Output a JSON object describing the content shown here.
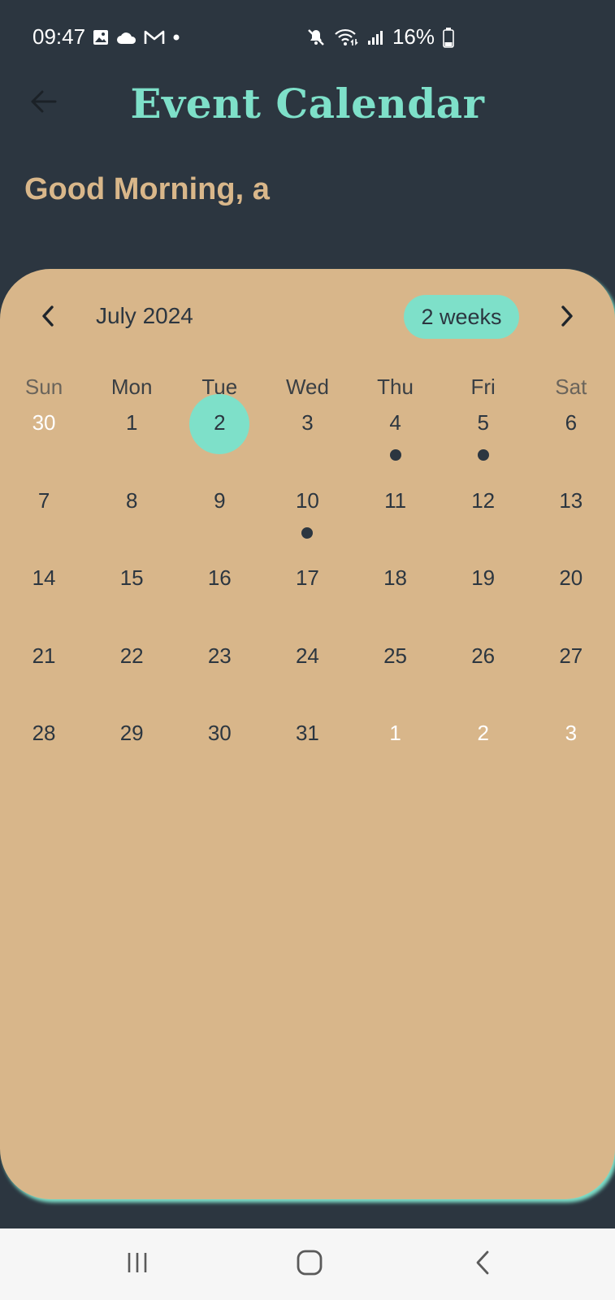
{
  "status_bar": {
    "time": "09:47",
    "battery": "16%",
    "left_icons": [
      "gallery-icon",
      "cloud-icon",
      "gmail-icon",
      "notification-dot-icon"
    ],
    "right_icons": [
      "mute-icon",
      "wifi-icon",
      "signal-icon",
      "battery-icon"
    ]
  },
  "app_bar": {
    "title": "Event Calendar",
    "title_color": "#7ee0c9",
    "back_icon": "arrow-left-icon"
  },
  "greeting": "Good Morning, a",
  "colors": {
    "background": "#2c3640",
    "card": "#d8b68a",
    "accent": "#7ee0c9",
    "greeting": "#d9b78a",
    "event_dot": "#2c3640"
  },
  "calendar": {
    "month_title": "July 2024",
    "format_button": "2 weeks",
    "prev_icon": "chevron-left-icon",
    "next_icon": "chevron-right-icon",
    "weekdays": [
      "Sun",
      "Mon",
      "Tue",
      "Wed",
      "Thu",
      "Fri",
      "Sat"
    ],
    "weeks": [
      [
        {
          "d": "30",
          "outside": true
        },
        {
          "d": "1"
        },
        {
          "d": "2",
          "today": true
        },
        {
          "d": "3"
        },
        {
          "d": "4",
          "event": true
        },
        {
          "d": "5",
          "event": true
        },
        {
          "d": "6"
        }
      ],
      [
        {
          "d": "7"
        },
        {
          "d": "8"
        },
        {
          "d": "9"
        },
        {
          "d": "10",
          "event": true
        },
        {
          "d": "11"
        },
        {
          "d": "12"
        },
        {
          "d": "13"
        }
      ],
      [
        {
          "d": "14"
        },
        {
          "d": "15"
        },
        {
          "d": "16"
        },
        {
          "d": "17"
        },
        {
          "d": "18"
        },
        {
          "d": "19"
        },
        {
          "d": "20"
        }
      ],
      [
        {
          "d": "21"
        },
        {
          "d": "22"
        },
        {
          "d": "23"
        },
        {
          "d": "24"
        },
        {
          "d": "25"
        },
        {
          "d": "26"
        },
        {
          "d": "27"
        }
      ],
      [
        {
          "d": "28"
        },
        {
          "d": "29"
        },
        {
          "d": "30"
        },
        {
          "d": "31"
        },
        {
          "d": "1",
          "outside": true
        },
        {
          "d": "2",
          "outside": true
        },
        {
          "d": "3",
          "outside": true
        }
      ]
    ]
  },
  "nav_bar": {
    "icons": [
      "recent-apps-icon",
      "home-icon",
      "back-icon"
    ]
  }
}
